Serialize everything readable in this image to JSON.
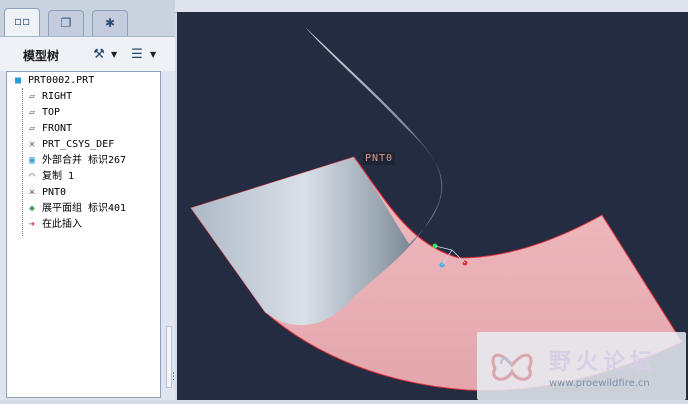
{
  "tabs": [
    {
      "icon": "model-tree-tab-icon",
      "active": true
    },
    {
      "icon": "folder-browser-tab-icon",
      "active": false
    },
    {
      "icon": "favorites-tab-icon",
      "active": false
    }
  ],
  "panel": {
    "title": "模型树"
  },
  "tree": {
    "root": "PRT0002.PRT",
    "items": [
      {
        "label": "RIGHT",
        "icon": "datum-plane-icon"
      },
      {
        "label": "TOP",
        "icon": "datum-plane-icon"
      },
      {
        "label": "FRONT",
        "icon": "datum-plane-icon"
      },
      {
        "label": "PRT_CSYS_DEF",
        "icon": "csys-icon"
      },
      {
        "label": "外部合并 标识267",
        "icon": "merge-feature-icon"
      },
      {
        "label": "复制 1",
        "icon": "copy-feature-icon"
      },
      {
        "label": "PNT0",
        "icon": "datum-point-icon"
      },
      {
        "label": "展平面组 标识401",
        "icon": "flatten-quilt-icon"
      },
      {
        "label": "在此插入",
        "icon": "insert-here-icon"
      }
    ]
  },
  "viewport": {
    "point_label": "PNT0"
  },
  "watermark": {
    "title": "野火论坛",
    "url": "www.proewildfire.cn"
  },
  "colors": {
    "viewport_bg": "#232c40",
    "flat_surface": "#e6b0b5",
    "curved_surface": "#b9c4cf",
    "edge": "#e0303a"
  }
}
